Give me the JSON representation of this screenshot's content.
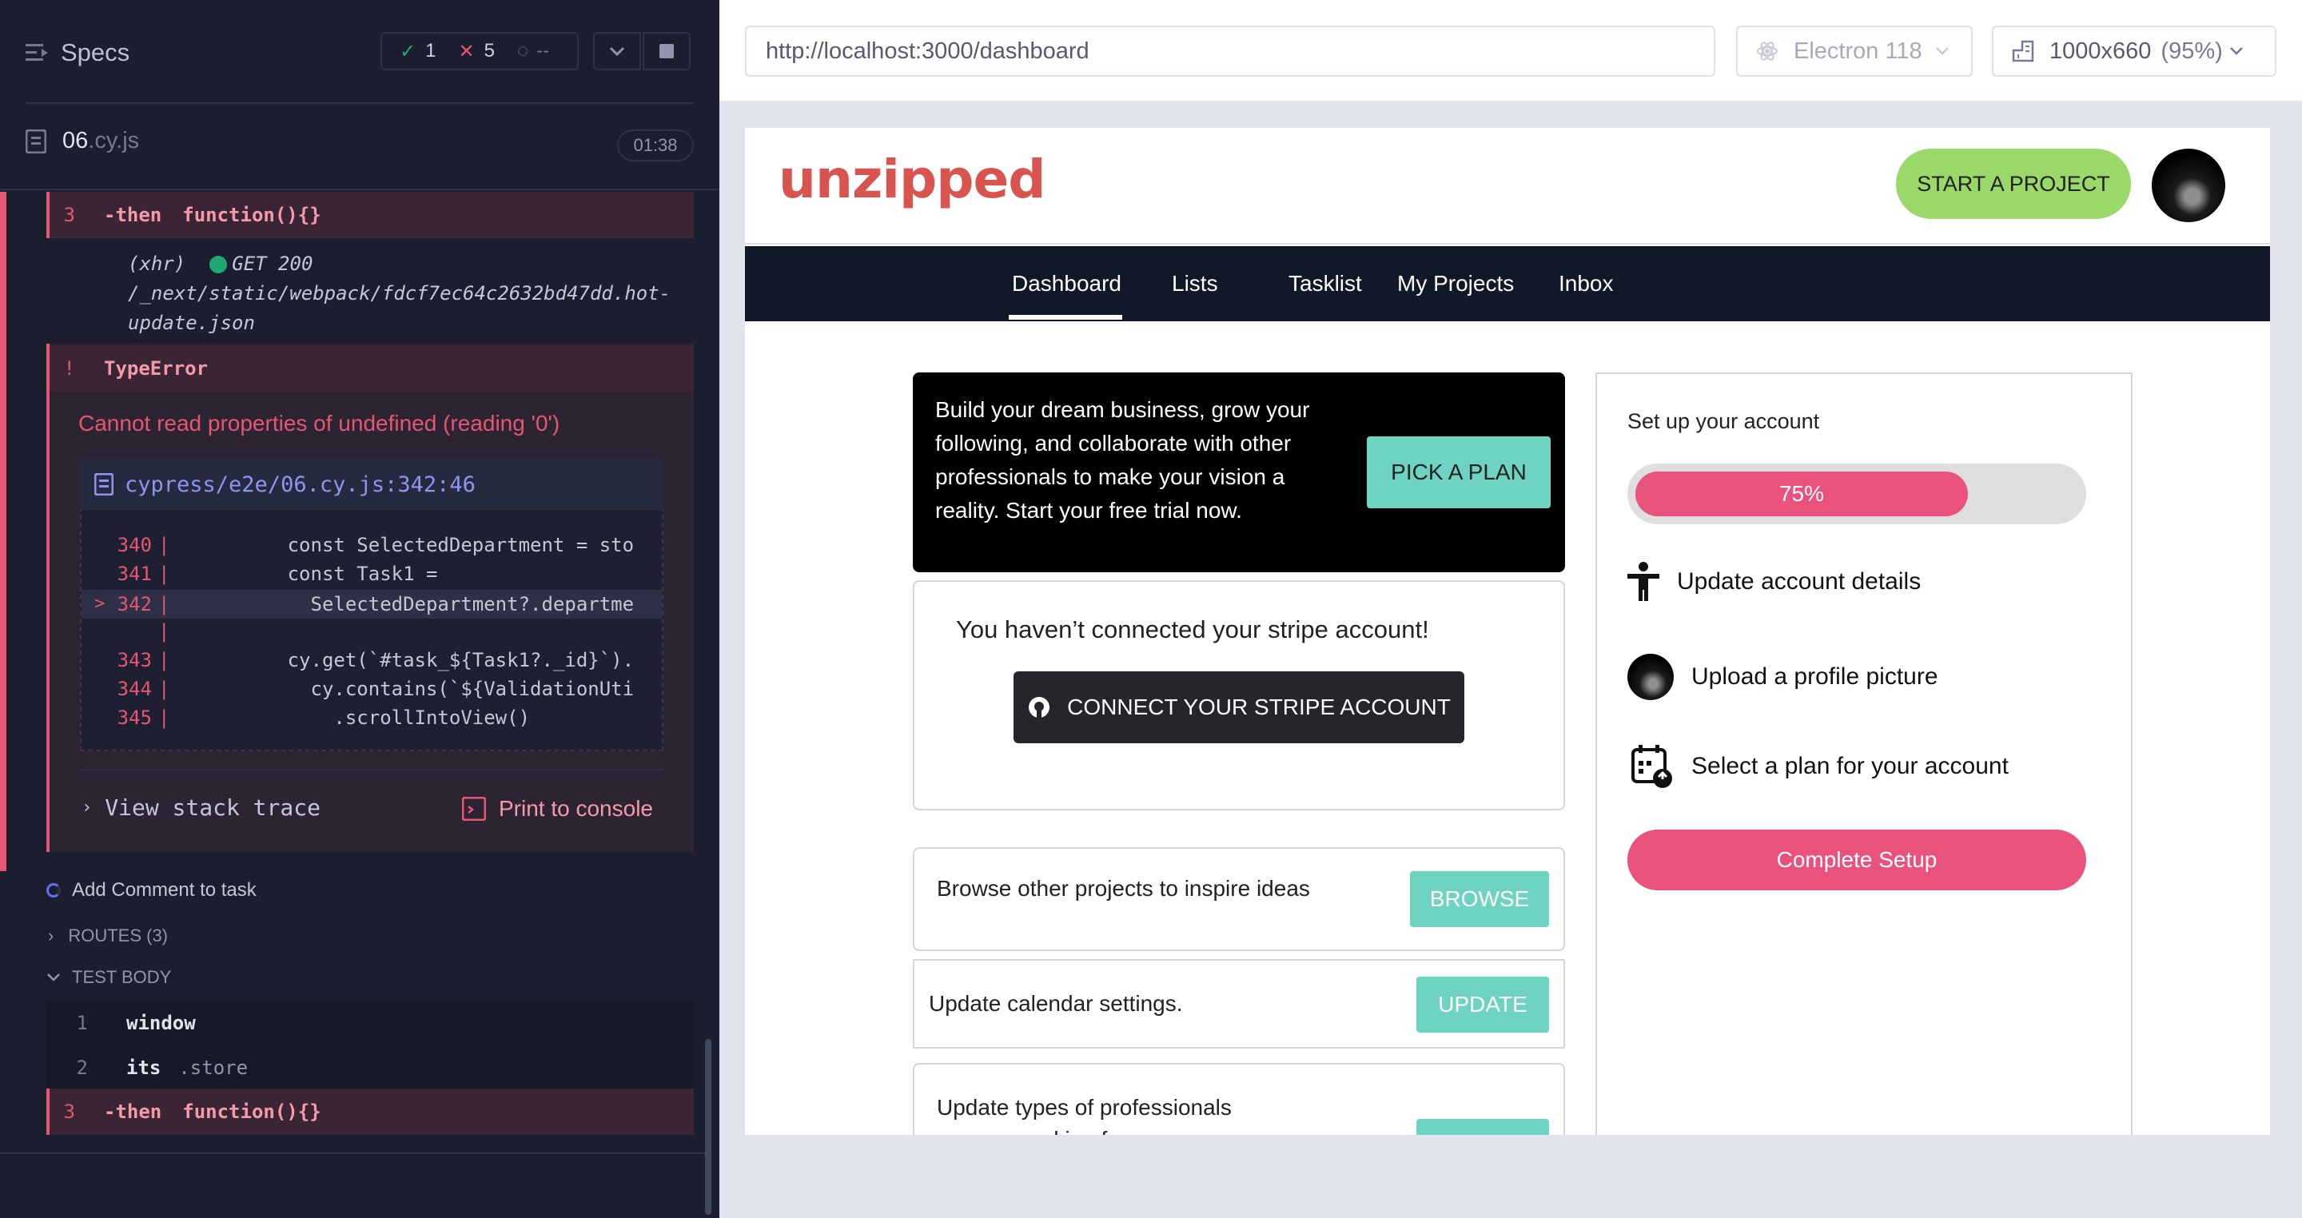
{
  "runner": {
    "specs_label": "Specs",
    "passed": "1",
    "failed": "5",
    "pending": "--",
    "spec_name": "06",
    "spec_ext": ".cy.js",
    "duration": "01:38",
    "top_cmd": {
      "num": "3",
      "cmd": "-then",
      "msg": "function(){}"
    },
    "xhr": {
      "type": "(xhr)",
      "status": "GET 200",
      "url_line1": "/_next/static/webpack/fdcf7ec64c2632bd47dd.hot-",
      "url_line2": "update.json"
    },
    "error": {
      "marker": "!",
      "name": "TypeError",
      "message": "Cannot read properties of undefined (reading '0')",
      "file": "cypress/e2e/06.cy.js:342:46",
      "code_lines": [
        {
          "num": "340",
          "code": "        const SelectedDepartment = sto"
        },
        {
          "num": "341",
          "code": "        const Task1 ="
        },
        {
          "num": "342",
          "code": "          SelectedDepartment?.departme"
        },
        {
          "num": "",
          "code": ""
        },
        {
          "num": "343",
          "code": "        cy.get(`#task_${Task1?._id}`)."
        },
        {
          "num": "344",
          "code": "          cy.contains(`${ValidationUti"
        },
        {
          "num": "345",
          "code": "            .scrollIntoView()"
        }
      ],
      "arrow": ">",
      "stack_trace": "View stack trace",
      "print_console": "Print to console"
    },
    "test_item": "Add Comment to task",
    "routes": "ROUTES (3)",
    "test_body": "TEST BODY",
    "body_cmds": [
      {
        "num": "1",
        "cmd": "window",
        "msg": ""
      },
      {
        "num": "2",
        "cmd": "its",
        "msg": ".store"
      },
      {
        "num": "3",
        "cmd": "-then",
        "msg": "function(){}"
      }
    ]
  },
  "browser": {
    "url": "http://localhost:3000/dashboard",
    "engine": "Electron 118",
    "viewport": "1000x660",
    "zoom": "(95%)"
  },
  "app": {
    "logo": "unzipped",
    "start_project": "START A PROJECT",
    "nav": [
      "Dashboard",
      "Lists",
      "Tasklist",
      "My Projects",
      "Inbox"
    ],
    "hero_text": "Build your dream business, grow your following, and collaborate with other professionals to make your vision a reality. Start your free trial now.",
    "pick_plan": "PICK A PLAN",
    "stripe_msg": "You haven’t connected your stripe account!",
    "stripe_btn": "CONNECT YOUR STRIPE ACCOUNT",
    "tasks": [
      {
        "text": "Browse other projects to inspire ideas",
        "btn": "BROWSE"
      },
      {
        "text": "Update calendar settings.",
        "btn": "UPDATE"
      },
      {
        "text": "Update types of professionals",
        "text2": "you are seeking for your",
        "btn": ""
      }
    ],
    "setup": {
      "title": "Set up your account",
      "progress_label": "75%",
      "progress": 0.75,
      "items": [
        "Update account details",
        "Upload a profile picture",
        "Select a plan for your account"
      ],
      "complete": "Complete Setup"
    },
    "colors": {
      "accent": "#e9527d",
      "teal": "#6ed4c1",
      "green": "#9bd86a",
      "logo": "#d9534f",
      "nav": "#111827"
    }
  }
}
